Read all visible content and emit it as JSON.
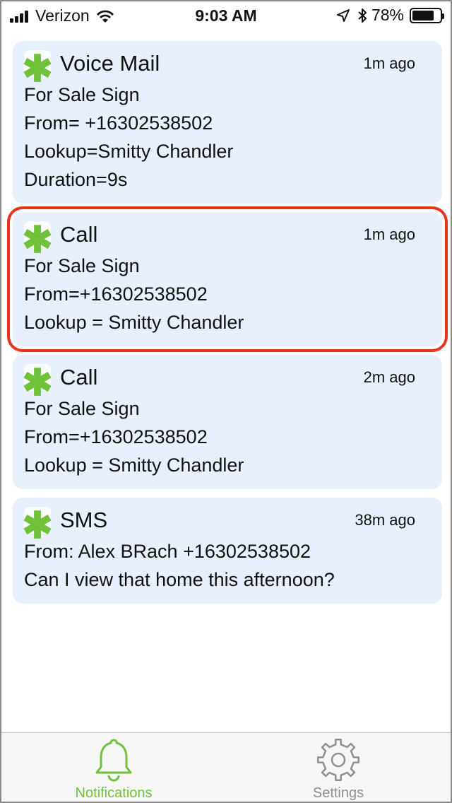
{
  "status_bar": {
    "carrier": "Verizon",
    "time": "9:03 AM",
    "battery_percent": "78%",
    "battery_level": 0.78,
    "icons": [
      "signal-icon",
      "wifi-icon",
      "location-arrow-icon",
      "bluetooth-icon",
      "battery-icon"
    ]
  },
  "notifications": [
    {
      "title": "Voice Mail",
      "time": "1m ago",
      "lines": [
        "For Sale Sign",
        "From= +16302538502",
        "Lookup=Smitty Chandler",
        "Duration=9s"
      ],
      "highlighted": false
    },
    {
      "title": "Call",
      "time": "1m ago",
      "lines": [
        "For Sale Sign",
        "From=+16302538502",
        "Lookup = Smitty Chandler"
      ],
      "highlighted": true
    },
    {
      "title": "Call",
      "time": "2m ago",
      "lines": [
        "For Sale Sign",
        "From=+16302538502",
        "Lookup = Smitty Chandler"
      ],
      "highlighted": false
    },
    {
      "title": "SMS",
      "time": "38m ago",
      "lines": [
        "From: Alex BRach +16302538502",
        "Can I view that home this afternoon?"
      ],
      "highlighted": false
    }
  ],
  "app_icon": {
    "glyph": "✱",
    "color": "#6fc23a"
  },
  "highlight_color": "#e8331f",
  "tab_bar": {
    "tabs": [
      {
        "label": "Notifications",
        "icon": "bell-icon",
        "active": true
      },
      {
        "label": "Settings",
        "icon": "gear-icon",
        "active": false
      }
    ],
    "active_color": "#6fc23a",
    "inactive_color": "#8e8e93"
  }
}
